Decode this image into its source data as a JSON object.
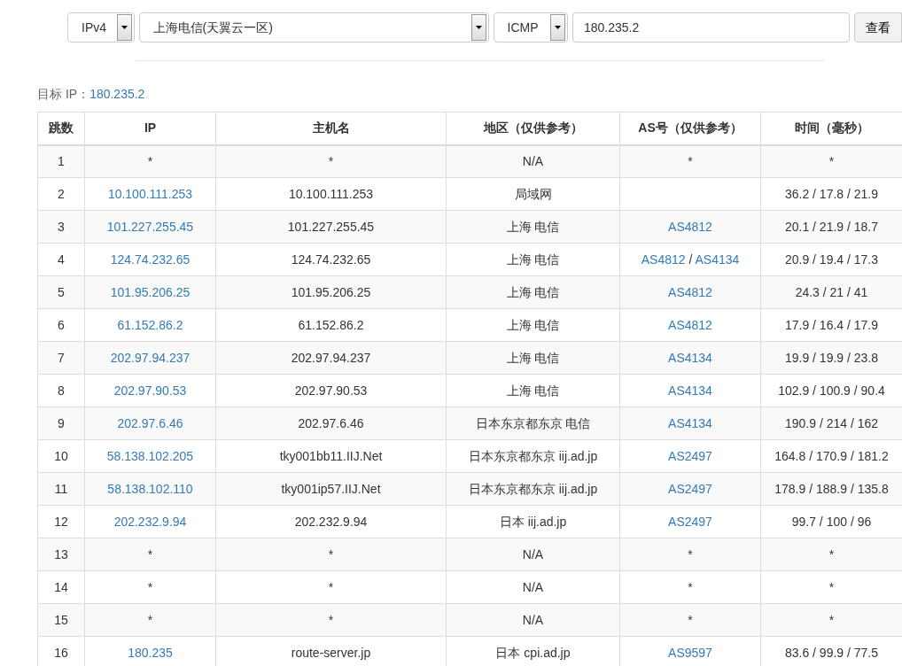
{
  "form": {
    "ip_version": "IPv4",
    "node": "上海电信(天翼云一区)",
    "protocol": "ICMP",
    "target": "180.235.2",
    "button": "查看"
  },
  "target_line": {
    "label": "目标 IP：",
    "ip": "180.235.2"
  },
  "table": {
    "columns": [
      "跳数",
      "IP",
      "主机名",
      "地区（仅供参考）",
      "AS号（仅供参考）",
      "时间（毫秒）"
    ],
    "rows": [
      {
        "hop": "1",
        "ip": "*",
        "ip_link": false,
        "host": "*",
        "region": "N/A",
        "as": [
          "*"
        ],
        "as_link": false,
        "time": "*"
      },
      {
        "hop": "2",
        "ip": "10.100.111.253",
        "ip_link": true,
        "host": "10.100.111.253",
        "region": "局域网",
        "as": [],
        "as_link": false,
        "time": "36.2 / 17.8 / 21.9"
      },
      {
        "hop": "3",
        "ip": "101.227.255.45",
        "ip_link": true,
        "host": "101.227.255.45",
        "region": "上海 电信",
        "as": [
          "AS4812"
        ],
        "as_link": true,
        "time": "20.1 / 21.9 / 18.7"
      },
      {
        "hop": "4",
        "ip": "124.74.232.65",
        "ip_link": true,
        "host": "124.74.232.65",
        "region": "上海 电信",
        "as": [
          "AS4812",
          "AS4134"
        ],
        "as_separator": "/",
        "as_link": true,
        "time": "20.9 / 19.4 / 17.3"
      },
      {
        "hop": "5",
        "ip": "101.95.206.25",
        "ip_link": true,
        "host": "101.95.206.25",
        "region": "上海 电信",
        "as": [
          "AS4812"
        ],
        "as_link": true,
        "time": "24.3 / 21 / 41"
      },
      {
        "hop": "6",
        "ip": "61.152.86.2",
        "ip_link": true,
        "host": "61.152.86.2",
        "region": "上海 电信",
        "as": [
          "AS4812"
        ],
        "as_link": true,
        "time": "17.9 / 16.4 / 17.9"
      },
      {
        "hop": "7",
        "ip": "202.97.94.237",
        "ip_link": true,
        "host": "202.97.94.237",
        "region": "上海 电信",
        "as": [
          "AS4134"
        ],
        "as_link": true,
        "time": "19.9 / 19.9 / 23.8"
      },
      {
        "hop": "8",
        "ip": "202.97.90.53",
        "ip_link": true,
        "host": "202.97.90.53",
        "region": "上海 电信",
        "as": [
          "AS4134"
        ],
        "as_link": true,
        "time": "102.9 / 100.9 / 90.4"
      },
      {
        "hop": "9",
        "ip": "202.97.6.46",
        "ip_link": true,
        "host": "202.97.6.46",
        "region": "日本东京都东京 电信",
        "as": [
          "AS4134"
        ],
        "as_link": true,
        "time": "190.9 / 214 / 162"
      },
      {
        "hop": "10",
        "ip": "58.138.102.205",
        "ip_link": true,
        "host": "tky001bb11.IIJ.Net",
        "region": "日本东京都东京 iij.ad.jp",
        "as": [
          "AS2497"
        ],
        "as_link": true,
        "time": "164.8 / 170.9 / 181.2"
      },
      {
        "hop": "11",
        "ip": "58.138.102.110",
        "ip_link": true,
        "host": "tky001ip57.IIJ.Net",
        "region": "日本东京都东京 iij.ad.jp",
        "as": [
          "AS2497"
        ],
        "as_link": true,
        "time": "178.9 / 188.9 / 135.8"
      },
      {
        "hop": "12",
        "ip": "202.232.9.94",
        "ip_link": true,
        "host": "202.232.9.94",
        "region": "日本 iij.ad.jp",
        "as": [
          "AS2497"
        ],
        "as_link": true,
        "time": "99.7 / 100 / 96"
      },
      {
        "hop": "13",
        "ip": "*",
        "ip_link": false,
        "host": "*",
        "region": "N/A",
        "as": [
          "*"
        ],
        "as_link": false,
        "time": "*"
      },
      {
        "hop": "14",
        "ip": "*",
        "ip_link": false,
        "host": "*",
        "region": "N/A",
        "as": [
          "*"
        ],
        "as_link": false,
        "time": "*"
      },
      {
        "hop": "15",
        "ip": "*",
        "ip_link": false,
        "host": "*",
        "region": "N/A",
        "as": [
          "*"
        ],
        "as_link": false,
        "time": "*"
      },
      {
        "hop": "16",
        "ip": "180.235",
        "ip_link": true,
        "host": "route-server.jp",
        "region": "日本 cpi.ad.jp",
        "as": [
          "AS9597"
        ],
        "as_link": true,
        "time": "83.6 / 99.9 / 77.5"
      }
    ]
  }
}
